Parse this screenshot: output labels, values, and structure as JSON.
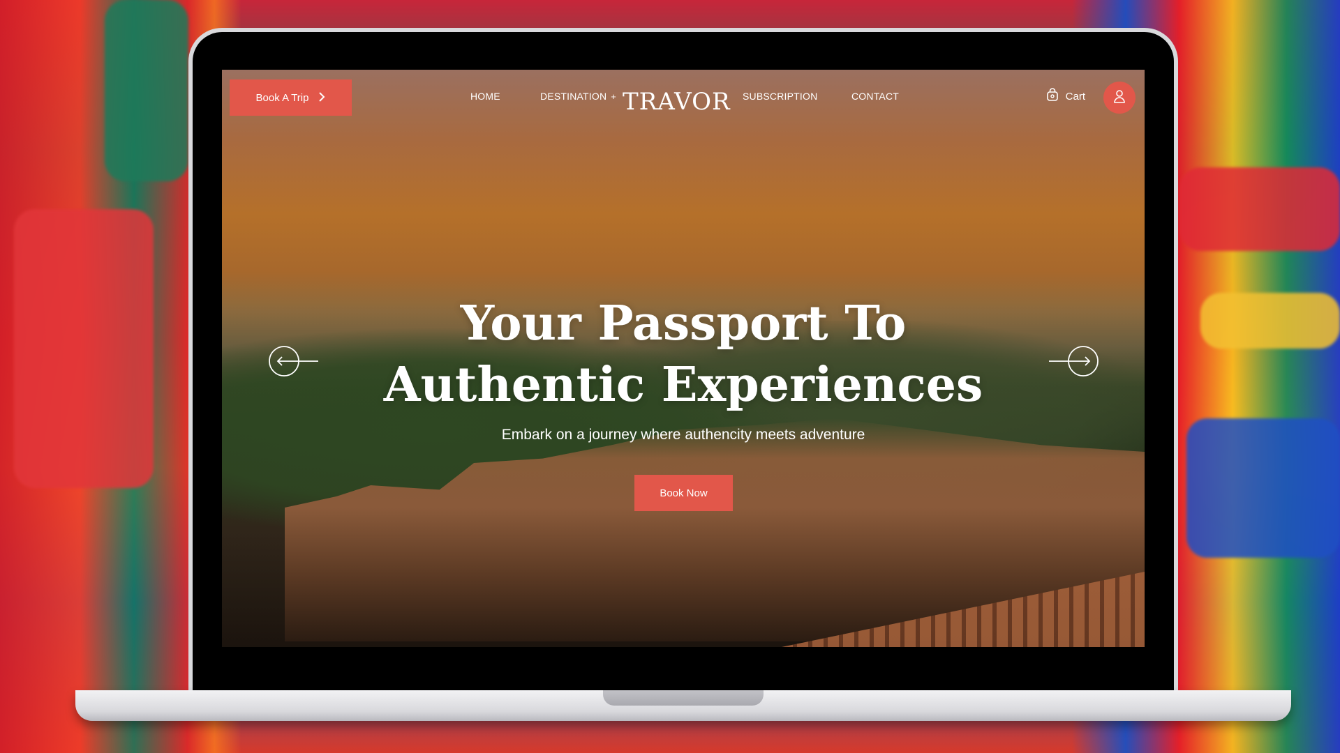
{
  "header": {
    "book_trip_label": "Book A Trip",
    "nav": {
      "home": "HOME",
      "destination": "DESTINATION",
      "destination_plus": "+",
      "subscription": "SUBSCRIPTION",
      "contact": "CONTACT"
    },
    "logo": "TRAVOR",
    "cart_label": "Cart"
  },
  "hero": {
    "title_line1": "Your Passport To",
    "title_line2": "Authentic Experiences",
    "subtitle": "Embark on a journey where authencity meets adventure",
    "cta_label": "Book Now"
  },
  "icons": {
    "chevron": "chevron-right-icon",
    "cart": "shopping-bag-icon",
    "profile": "user-icon",
    "prev": "arrow-left-icon",
    "next": "arrow-right-icon"
  },
  "colors": {
    "accent": "#e2574a"
  }
}
